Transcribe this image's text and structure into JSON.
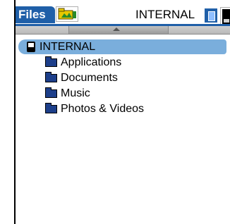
{
  "header": {
    "app_name": "Files",
    "volume_title": "INTERNAL"
  },
  "icons": {
    "app_icon": "folder-app-icon",
    "card_volume": "memory-card-icon",
    "device_volume": "device-icon",
    "scroll_up": "scroll-up-arrow-icon"
  },
  "tree": {
    "root": {
      "label": "INTERNAL",
      "icon": "device-icon",
      "selected": true
    },
    "folders": [
      {
        "label": "Applications",
        "icon": "folder-icon"
      },
      {
        "label": "Documents",
        "icon": "folder-icon"
      },
      {
        "label": "Music",
        "icon": "folder-icon"
      },
      {
        "label": "Photos & Videos",
        "icon": "folder-icon"
      }
    ]
  },
  "colors": {
    "accent": "#1f5fa8",
    "selection": "#7aaedc"
  }
}
